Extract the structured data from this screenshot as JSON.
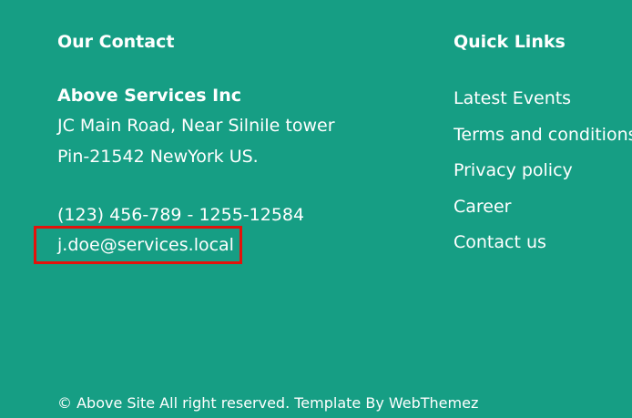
{
  "colors": {
    "background": "#169e84",
    "text": "#ffffff",
    "highlight_border": "#e3120b"
  },
  "contact": {
    "heading": "Our Contact",
    "company": "Above Services Inc",
    "address_line1": "JC Main Road, Near Silnile tower",
    "address_line2": "Pin-21542 NewYork US.",
    "phone": "(123) 456-789 - 1255-12584",
    "email": "j.doe@services.local"
  },
  "quick_links": {
    "heading": "Quick Links",
    "items": [
      {
        "label": "Latest Events"
      },
      {
        "label": "Terms and conditions"
      },
      {
        "label": "Privacy policy"
      },
      {
        "label": "Career"
      },
      {
        "label": "Contact us"
      }
    ]
  },
  "footer": {
    "copyright": "© Above Site All right reserved. Template By WebThemez"
  }
}
